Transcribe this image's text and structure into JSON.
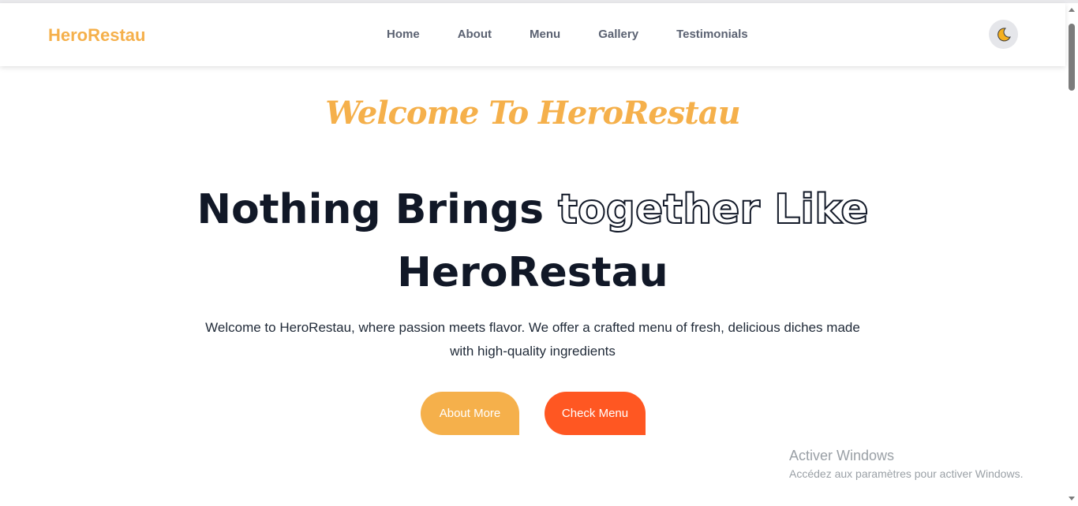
{
  "header": {
    "logo": "HeroRestau",
    "nav": [
      "Home",
      "About",
      "Menu",
      "Gallery",
      "Testimonials"
    ],
    "theme_toggle_icon": "moon-icon"
  },
  "hero": {
    "welcome_script": "Welcome To HeroRestau",
    "headline_part1": "Nothing Brings",
    "headline_outline": "together Like",
    "headline_part2": "HeroRestau",
    "description": "Welcome to HeroRestau, where passion meets flavor. We offer a crafted menu of fresh, delicious diches made with high-quality ingredients",
    "buttons": {
      "about": "About More",
      "menu": "Check Menu"
    }
  },
  "watermark": {
    "title": "Activer Windows",
    "subtitle": "Accédez aux paramètres pour activer Windows."
  },
  "colors": {
    "brand": "#f5b04b",
    "accent": "#ff5722",
    "text": "#111827"
  }
}
